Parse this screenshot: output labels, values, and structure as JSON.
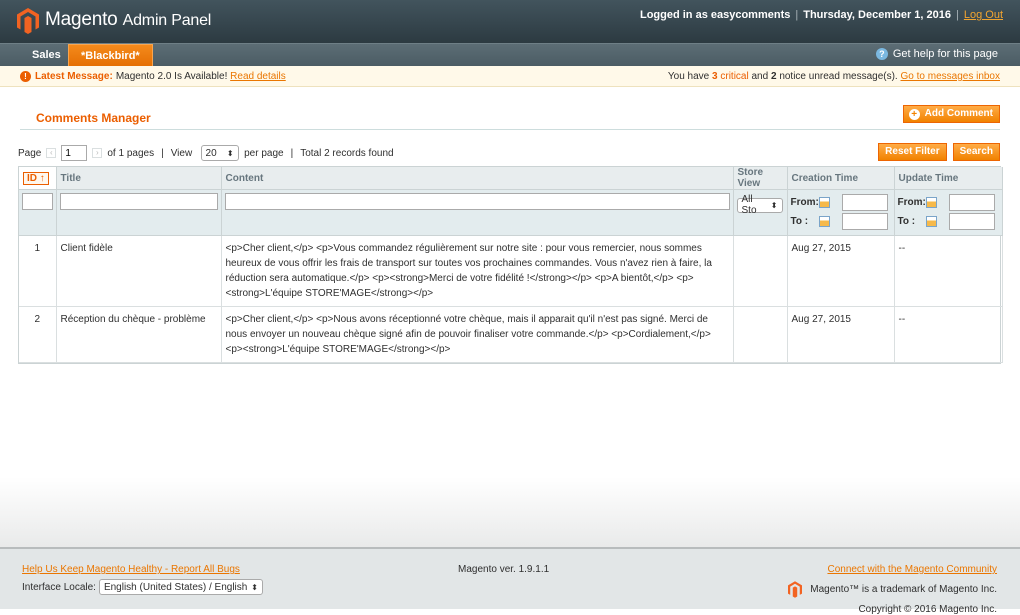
{
  "header": {
    "logo_main": "Magento",
    "logo_sub": "Admin Panel",
    "logged_in": "Logged in as easycomments",
    "date": "Thursday, December 1, 2016",
    "logout": "Log Out"
  },
  "nav": {
    "items": [
      {
        "label": "Sales"
      },
      {
        "label": "*Blackbird*"
      }
    ],
    "help": "Get help for this page"
  },
  "message_bar": {
    "latest_label": "Latest Message:",
    "latest_text": "Magento 2.0 Is Available!",
    "read_details": "Read details",
    "you_have": "You have",
    "critical_count": "3",
    "critical_label": "critical",
    "and": "and",
    "notice_count": "2",
    "notice_text": "notice unread message(s).",
    "inbox_link": "Go to messages inbox"
  },
  "page": {
    "title": "Comments Manager",
    "add_button": "Add Comment"
  },
  "pager": {
    "page_label": "Page",
    "page_value": "1",
    "of_pages": "of 1 pages",
    "view_label": "View",
    "per_page_value": "20",
    "per_page_label": "per page",
    "total": "Total 2 records found",
    "reset_filter": "Reset Filter",
    "search": "Search"
  },
  "grid": {
    "columns": [
      "ID",
      "Title",
      "Content",
      "Store View",
      "Creation Time",
      "Update Time"
    ],
    "store_filter": "All Sto",
    "from_label": "From:",
    "to_label": "To :",
    "rows": [
      {
        "id": "1",
        "title": "Client fidèle",
        "content": "<p>Cher client,</p> <p>Vous commandez régulièrement sur notre site : pour vous remercier, nous sommes heureux de vous offrir les frais de transport sur toutes vos prochaines commandes. Vous n'avez rien à faire, la réduction sera automatique.</p> <p><strong>Merci de votre fidélité !</strong></p> <p>A bientôt,</p> <p><strong>L'équipe STORE'MAGE</strong></p>",
        "store": "",
        "created": "Aug 27, 2015",
        "updated": "--"
      },
      {
        "id": "2",
        "title": "Réception du chèque - problème",
        "content": "<p>Cher client,</p> <p>Nous avons réceptionné votre chèque, mais il apparait qu'il n'est pas signé. Merci de nous envoyer un nouveau chèque signé afin de pouvoir finaliser votre commande.</p> <p>Cordialement,</p> <p><strong>L'équipe STORE'MAGE</strong></p>",
        "store": "",
        "created": "Aug 27, 2015",
        "updated": "--"
      }
    ]
  },
  "footer": {
    "bugs_link": "Help Us Keep Magento Healthy - Report All Bugs",
    "locale_label": "Interface Locale:",
    "locale_value": "English (United States) / English",
    "version": "Magento ver. 1.9.1.1",
    "community_link": "Connect with the Magento Community",
    "trademark": "Magento™ is a trademark of Magento Inc.",
    "copyright": "Copyright © 2016 Magento Inc."
  },
  "colors": {
    "accent": "#eb5e00",
    "header": "#2c3a41",
    "button": "#f18200"
  }
}
